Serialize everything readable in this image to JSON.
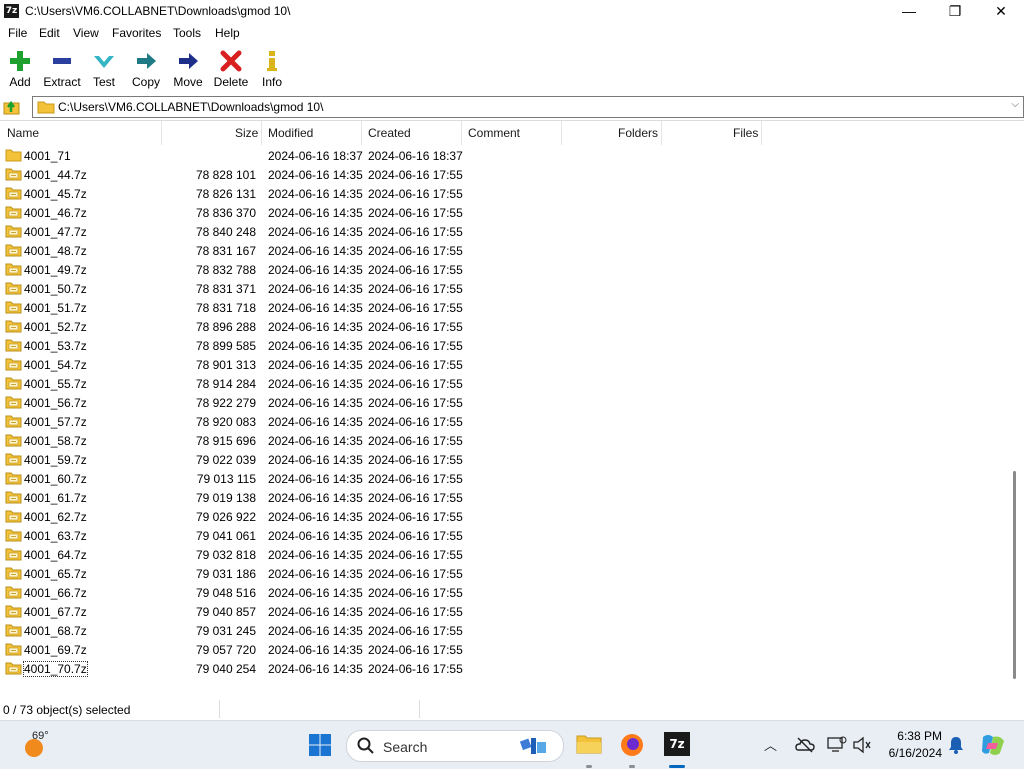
{
  "window": {
    "app_icon": "7z",
    "title": "C:\\Users\\VM6.COLLABNET\\Downloads\\gmod 10\\",
    "minimize_glyph": "—",
    "maximize_glyph": "❐",
    "close_glyph": "✕"
  },
  "menu": [
    "File",
    "Edit",
    "View",
    "Favorites",
    "Tools",
    "Help"
  ],
  "toolbar": {
    "add": "Add",
    "extract": "Extract",
    "test": "Test",
    "copy": "Copy",
    "move": "Move",
    "delete": "Delete",
    "info": "Info"
  },
  "address": {
    "path": "C:\\Users\\VM6.COLLABNET\\Downloads\\gmod 10\\",
    "chevron": "⌵"
  },
  "columns": {
    "name": "Name",
    "size": "Size",
    "modified": "Modified",
    "created": "Created",
    "comment": "Comment",
    "folders": "Folders",
    "files": "Files"
  },
  "rows": [
    {
      "name": "4001_71",
      "size": "",
      "modified": "2024-06-16 18:37",
      "created": "2024-06-16 18:37",
      "type": "folder"
    },
    {
      "name": "4001_44.7z",
      "size": "78 828 101",
      "modified": "2024-06-16 14:35",
      "created": "2024-06-16 17:55",
      "type": "archive"
    },
    {
      "name": "4001_45.7z",
      "size": "78 826 131",
      "modified": "2024-06-16 14:35",
      "created": "2024-06-16 17:55",
      "type": "archive"
    },
    {
      "name": "4001_46.7z",
      "size": "78 836 370",
      "modified": "2024-06-16 14:35",
      "created": "2024-06-16 17:55",
      "type": "archive"
    },
    {
      "name": "4001_47.7z",
      "size": "78 840 248",
      "modified": "2024-06-16 14:35",
      "created": "2024-06-16 17:55",
      "type": "archive"
    },
    {
      "name": "4001_48.7z",
      "size": "78 831 167",
      "modified": "2024-06-16 14:35",
      "created": "2024-06-16 17:55",
      "type": "archive"
    },
    {
      "name": "4001_49.7z",
      "size": "78 832 788",
      "modified": "2024-06-16 14:35",
      "created": "2024-06-16 17:55",
      "type": "archive"
    },
    {
      "name": "4001_50.7z",
      "size": "78 831 371",
      "modified": "2024-06-16 14:35",
      "created": "2024-06-16 17:55",
      "type": "archive"
    },
    {
      "name": "4001_51.7z",
      "size": "78 831 718",
      "modified": "2024-06-16 14:35",
      "created": "2024-06-16 17:55",
      "type": "archive"
    },
    {
      "name": "4001_52.7z",
      "size": "78 896 288",
      "modified": "2024-06-16 14:35",
      "created": "2024-06-16 17:55",
      "type": "archive"
    },
    {
      "name": "4001_53.7z",
      "size": "78 899 585",
      "modified": "2024-06-16 14:35",
      "created": "2024-06-16 17:55",
      "type": "archive"
    },
    {
      "name": "4001_54.7z",
      "size": "78 901 313",
      "modified": "2024-06-16 14:35",
      "created": "2024-06-16 17:55",
      "type": "archive"
    },
    {
      "name": "4001_55.7z",
      "size": "78 914 284",
      "modified": "2024-06-16 14:35",
      "created": "2024-06-16 17:55",
      "type": "archive"
    },
    {
      "name": "4001_56.7z",
      "size": "78 922 279",
      "modified": "2024-06-16 14:35",
      "created": "2024-06-16 17:55",
      "type": "archive"
    },
    {
      "name": "4001_57.7z",
      "size": "78 920 083",
      "modified": "2024-06-16 14:35",
      "created": "2024-06-16 17:55",
      "type": "archive"
    },
    {
      "name": "4001_58.7z",
      "size": "78 915 696",
      "modified": "2024-06-16 14:35",
      "created": "2024-06-16 17:55",
      "type": "archive"
    },
    {
      "name": "4001_59.7z",
      "size": "79 022 039",
      "modified": "2024-06-16 14:35",
      "created": "2024-06-16 17:55",
      "type": "archive"
    },
    {
      "name": "4001_60.7z",
      "size": "79 013 115",
      "modified": "2024-06-16 14:35",
      "created": "2024-06-16 17:55",
      "type": "archive"
    },
    {
      "name": "4001_61.7z",
      "size": "79 019 138",
      "modified": "2024-06-16 14:35",
      "created": "2024-06-16 17:55",
      "type": "archive"
    },
    {
      "name": "4001_62.7z",
      "size": "79 026 922",
      "modified": "2024-06-16 14:35",
      "created": "2024-06-16 17:55",
      "type": "archive"
    },
    {
      "name": "4001_63.7z",
      "size": "79 041 061",
      "modified": "2024-06-16 14:35",
      "created": "2024-06-16 17:55",
      "type": "archive"
    },
    {
      "name": "4001_64.7z",
      "size": "79 032 818",
      "modified": "2024-06-16 14:35",
      "created": "2024-06-16 17:55",
      "type": "archive"
    },
    {
      "name": "4001_65.7z",
      "size": "79 031 186",
      "modified": "2024-06-16 14:35",
      "created": "2024-06-16 17:55",
      "type": "archive"
    },
    {
      "name": "4001_66.7z",
      "size": "79 048 516",
      "modified": "2024-06-16 14:35",
      "created": "2024-06-16 17:55",
      "type": "archive"
    },
    {
      "name": "4001_67.7z",
      "size": "79 040 857",
      "modified": "2024-06-16 14:35",
      "created": "2024-06-16 17:55",
      "type": "archive"
    },
    {
      "name": "4001_68.7z",
      "size": "79 031 245",
      "modified": "2024-06-16 14:35",
      "created": "2024-06-16 17:55",
      "type": "archive"
    },
    {
      "name": "4001_69.7z",
      "size": "79 057 720",
      "modified": "2024-06-16 14:35",
      "created": "2024-06-16 17:55",
      "type": "archive"
    },
    {
      "name": "4001_70.7z",
      "size": "79 040 254",
      "modified": "2024-06-16 14:35",
      "created": "2024-06-16 17:55",
      "type": "archive",
      "focused": true
    }
  ],
  "status": {
    "selection": "0 / 73 object(s) selected"
  },
  "taskbar": {
    "temperature": "69°",
    "search_label": "Search",
    "time": "6:38 PM",
    "date": "6/16/2024",
    "active_app": "7z",
    "tray_chevron": "︿"
  },
  "colors": {
    "add_icon": "#1fa12f",
    "extract_icon": "#2b3f9e",
    "test_icon": "#34b6c4",
    "copy_icon": "#1f7a86",
    "move_icon": "#1e2f8a",
    "delete_icon": "#d92020",
    "info_icon": "#d9b51a",
    "folder_icon": "#f3c238",
    "taskbar_accent": "#0067c0"
  }
}
